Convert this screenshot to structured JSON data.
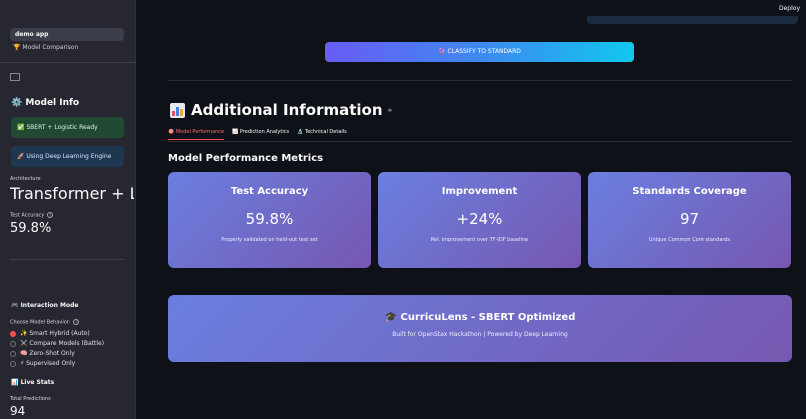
{
  "sidebar": {
    "nav": [
      {
        "label": "demo app",
        "icon": ""
      },
      {
        "label": "Model Comparison",
        "icon": "🏆"
      }
    ],
    "model_info": {
      "title": "Model Info",
      "icon": "⚙️",
      "status_success": "✅ SBERT + Logistic Ready",
      "status_info": "🚀 Using Deep Learning Engine",
      "architecture_label": "Architecture",
      "architecture_value": "Transformer + Li...",
      "accuracy_label": "Test Accuracy",
      "accuracy_value": "59.8%"
    },
    "interaction_mode": {
      "title": "Interaction Mode",
      "icon": "🎮",
      "prompt": "Choose Model Behavior:",
      "options": [
        {
          "label": "✨ Smart Hybrid (Auto)",
          "selected": true
        },
        {
          "label": "⚔️ Compare Models (Battle)",
          "selected": false
        },
        {
          "label": "🧠 Zero-Shot Only",
          "selected": false
        },
        {
          "label": "⚡ Supervised Only",
          "selected": false
        }
      ]
    },
    "live_stats": {
      "title": "Live Stats",
      "icon": "📊",
      "total_label": "Total Predictions",
      "total_value": "94"
    }
  },
  "header": {
    "deploy_label": "Deploy"
  },
  "main": {
    "classify_button": "🔮 CLASSIFY TO STANDARD",
    "section_title": "Additional Information",
    "tabs": [
      {
        "label": "🎯 Model Performance",
        "active": true
      },
      {
        "label": "📈 Prediction Analytics",
        "active": false
      },
      {
        "label": "🔬 Technical Details",
        "active": false
      }
    ],
    "metrics_heading": "Model Performance Metrics",
    "cards": [
      {
        "title": "Test Accuracy",
        "value": "59.8%",
        "subtitle": "Properly validated on held-out test set"
      },
      {
        "title": "Improvement",
        "value": "+24%",
        "subtitle": "Rel. improvement over TF-IDF baseline"
      },
      {
        "title": "Standards Coverage",
        "value": "97",
        "subtitle": "Unique Common Core standards"
      }
    ],
    "banner": {
      "title": "🎓 CurricuLens - SBERT Optimized",
      "subtitle": "Built for OpenStax Hackathon | Powered by Deep Learning"
    }
  },
  "colors": {
    "background": "#0e1117",
    "sidebar": "#262730",
    "accent": "#ff4b4b",
    "card_gradient_start": "#6a7fe0",
    "card_gradient_end": "#7658b0"
  }
}
